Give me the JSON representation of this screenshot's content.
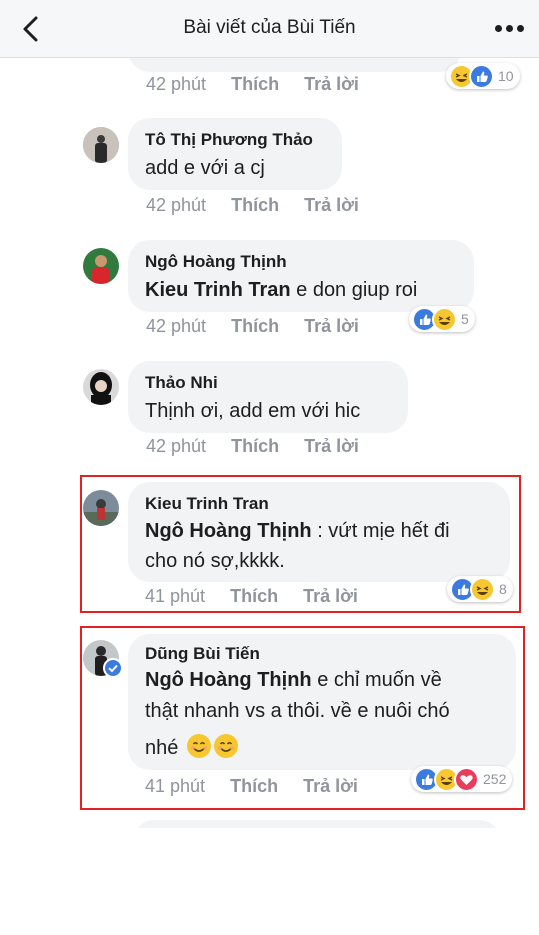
{
  "header": {
    "title": "Bài viết của Bùi Tiến"
  },
  "labels": {
    "like": "Thích",
    "reply": "Trả lời"
  },
  "comments": [
    {
      "time": "42 phút",
      "reactions": [
        "haha",
        "like"
      ],
      "reaction_count": "10"
    },
    {
      "author": "Tô Thị Phương Thảo",
      "text": "add e với a cj",
      "time": "42 phút"
    },
    {
      "author": "Ngô Hoàng Thịnh",
      "mention": "Kieu Trinh Tran",
      "text": " e don giup roi",
      "time": "42 phút",
      "reactions": [
        "like",
        "haha"
      ],
      "reaction_count": "5"
    },
    {
      "author": "Thảo Nhi",
      "text": "Thịnh ơi, add em với hic",
      "time": "42 phút"
    },
    {
      "author": "Kieu Trinh Tran",
      "mention": "Ngô Hoàng Thịnh",
      "text_line1": " : vứt mịe hết đi",
      "text_line2": "cho nó sợ,kkkk.",
      "time": "41 phút",
      "reactions": [
        "like",
        "haha"
      ],
      "reaction_count": "8"
    },
    {
      "author": "Dũng Bùi Tiến",
      "mention": "Ngô Hoàng Thịnh",
      "text_line1": "  e chỉ muốn về",
      "text_line2": "thật nhanh vs a thôi. về e nuôi chó",
      "text_line3": "nhé",
      "time": "41 phút",
      "reactions": [
        "like",
        "haha",
        "love"
      ],
      "reaction_count": "252"
    }
  ],
  "colors": {
    "highlight": "#e02222",
    "bubble": "#f2f3f5",
    "meta": "#90949c",
    "like": "#3b7be0",
    "haha": "#f7c730",
    "love": "#e83e5c"
  }
}
